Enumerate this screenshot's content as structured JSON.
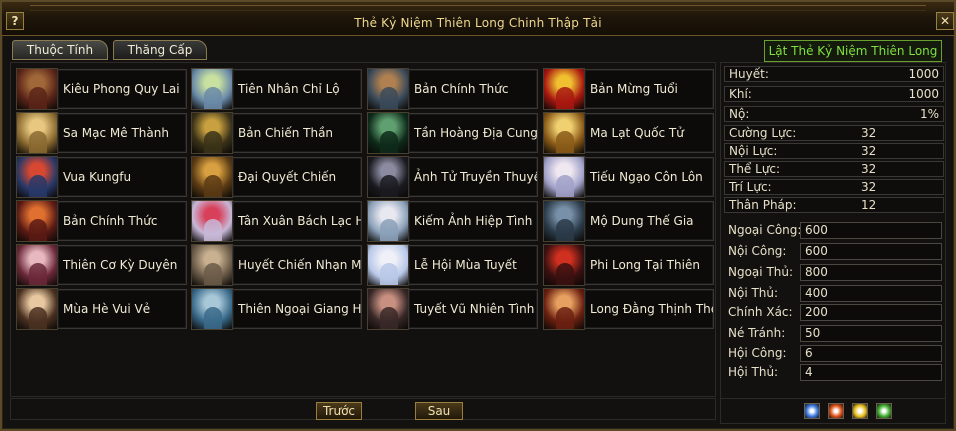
{
  "window": {
    "title": "Thẻ Kỷ Niệm Thiên Long Chinh Thập Tải",
    "help_label": "?",
    "close_label": "✕"
  },
  "tabs": [
    {
      "label": "Thuộc Tính"
    },
    {
      "label": "Thăng Cấp"
    }
  ],
  "flip_button": "Lật Thẻ Kỷ Niệm Thiên Long",
  "cards": [
    {
      "label": "Kiêu Phong Quy Lai",
      "colors": [
        "#5a2418",
        "#a06838"
      ]
    },
    {
      "label": "Tiên Nhân Chỉ Lộ",
      "colors": [
        "#6a8aa8",
        "#c8e0a0"
      ]
    },
    {
      "label": "Bản Chính Thức",
      "colors": [
        "#3a4a5a",
        "#b08050"
      ]
    },
    {
      "label": "Bản Mừng Tuổi",
      "colors": [
        "#a81810",
        "#f0c030"
      ]
    },
    {
      "label": "Sa Mạc Mê Thành",
      "colors": [
        "#8a6a30",
        "#e8c880"
      ]
    },
    {
      "label": "Bản Chiến Thần",
      "colors": [
        "#3a3218",
        "#c8a040"
      ]
    },
    {
      "label": "Tần Hoàng Địa Cung",
      "colors": [
        "#0e2a1a",
        "#60a070"
      ]
    },
    {
      "label": "Ma Lạt Quốc Tử",
      "colors": [
        "#8a5a18",
        "#f0d070"
      ]
    },
    {
      "label": "Vua Kungfu",
      "colors": [
        "#283868",
        "#d84830"
      ]
    },
    {
      "label": "Đại Quyết Chiến",
      "colors": [
        "#5a3a14",
        "#d8a040"
      ]
    },
    {
      "label": "Ảnh Tử Truyền Thuyết",
      "colors": [
        "#1a1a20",
        "#8a8aa0"
      ]
    },
    {
      "label": "Tiếu Ngạo Côn Lôn",
      "colors": [
        "#a0a0c8",
        "#f0e8f0"
      ]
    },
    {
      "label": "Bản Chính Thức",
      "colors": [
        "#5a1a14",
        "#e07030"
      ]
    },
    {
      "label": "Tân Xuân Bách Lạc Hội",
      "colors": [
        "#c8b8d8",
        "#d8405a"
      ]
    },
    {
      "label": "Kiếm Ảnh Hiệp Tình",
      "colors": [
        "#8aa0b8",
        "#e8e8f0"
      ]
    },
    {
      "label": "Mộ Dung Thế Gia",
      "colors": [
        "#2a3a48",
        "#7890a8"
      ]
    },
    {
      "label": "Thiên Cơ Kỳ Duyên",
      "colors": [
        "#6a2838",
        "#e8b8c0"
      ]
    },
    {
      "label": "Huyết Chiến Nhạn Môn",
      "colors": [
        "#6a5a48",
        "#c8b090"
      ]
    },
    {
      "label": "Lễ Hội Mùa Tuyết",
      "colors": [
        "#b8c8e8",
        "#f0f0f8"
      ]
    },
    {
      "label": "Phi Long Tại Thiên",
      "colors": [
        "#3a1010",
        "#d03020"
      ]
    },
    {
      "label": "Mùa Hè Vui Vẻ",
      "colors": [
        "#4a3020",
        "#e8c8a0"
      ]
    },
    {
      "label": "Thiên Ngoại Giang Hồ",
      "colors": [
        "#3a6a8a",
        "#a8c8d8"
      ]
    },
    {
      "label": "Tuyết Vũ Nhiên Tình",
      "colors": [
        "#382828",
        "#c89080"
      ]
    },
    {
      "label": "Long Đằng Thịnh Thế",
      "colors": [
        "#6a2010",
        "#e8a060"
      ]
    }
  ],
  "nav": {
    "prev": "Trước",
    "next": "Sau"
  },
  "vitals": [
    {
      "name": "Huyết:",
      "value": "1000"
    },
    {
      "name": "Khí:",
      "value": "1000"
    },
    {
      "name": "Nộ:",
      "value": "1%"
    }
  ],
  "base_stats": [
    {
      "name": "Cường Lực:",
      "value": "32"
    },
    {
      "name": "Nội Lực:",
      "value": "32"
    },
    {
      "name": "Thể Lực:",
      "value": "32"
    },
    {
      "name": "Trí Lực:",
      "value": "32"
    },
    {
      "name": "Thân Pháp:",
      "value": "12"
    }
  ],
  "attributes": [
    {
      "name": "Ngoại Công:",
      "value": "600"
    },
    {
      "name": "Nội Công:",
      "value": "600"
    },
    {
      "name": "Ngoại Thủ:",
      "value": "800"
    },
    {
      "name": "Nội Thủ:",
      "value": "400"
    },
    {
      "name": "Chính Xác:",
      "value": "200"
    },
    {
      "name": "Né Tránh:",
      "value": "50"
    },
    {
      "name": "Hội Công:",
      "value": "6"
    },
    {
      "name": "Hội Thủ:",
      "value": "4"
    }
  ],
  "element_icons": [
    {
      "name": "ice-element-icon",
      "color": "#3a78e0"
    },
    {
      "name": "fire-element-icon",
      "color": "#e05018"
    },
    {
      "name": "lightning-element-icon",
      "color": "#e8c020"
    },
    {
      "name": "poison-element-icon",
      "color": "#40b030"
    }
  ]
}
